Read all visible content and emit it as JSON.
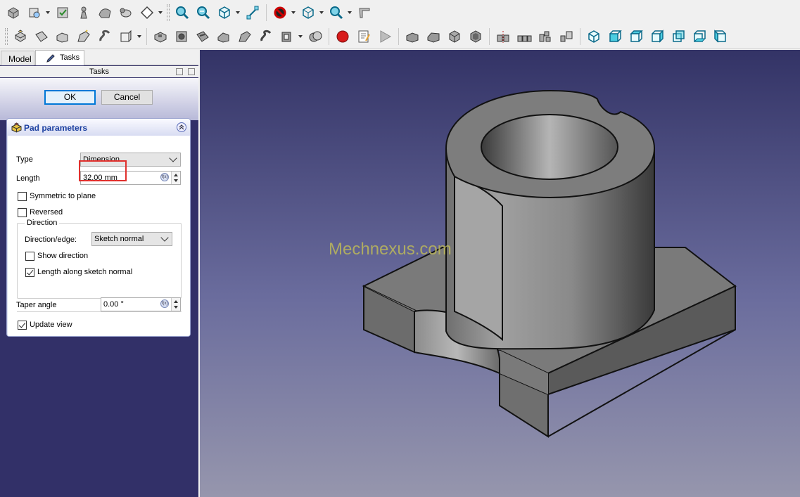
{
  "tabs": [
    {
      "label": "Model"
    },
    {
      "label": "Tasks"
    }
  ],
  "panel_title": "Tasks",
  "buttons": {
    "ok": "OK",
    "cancel": "Cancel"
  },
  "pad": {
    "title": "Pad parameters",
    "type_label": "Type",
    "type_value": "Dimension",
    "length_label": "Length",
    "length_value": "32.00 mm",
    "symmetric_label": "Symmetric to plane",
    "symmetric_checked": false,
    "reversed_label": "Reversed",
    "reversed_checked": false,
    "direction": {
      "group_title": "Direction",
      "edge_label": "Direction/edge:",
      "edge_value": "Sketch normal",
      "show_direction_label": "Show direction",
      "show_direction_checked": false,
      "along_normal_label": "Length along sketch normal",
      "along_normal_checked": true
    },
    "taper_label": "Taper angle",
    "taper_value": "0.00 °",
    "update_view_label": "Update view",
    "update_view_checked": true
  },
  "viewport": {
    "watermark": "Mechnexus.com"
  },
  "toolbar1_icons": [
    "part-icon",
    "clone-icon",
    "check-geometry-icon",
    "pawn-icon",
    "shape-binder-icon",
    "sheep-icon",
    "diamond-sketch-icon",
    "zoom-fit-icon",
    "zoom-selection-icon",
    "view-isometric-icon",
    "measure-icon",
    "no-draw-style-icon",
    "bounding-box-icon",
    "zoom-dropdown-icon",
    "caliper-icon"
  ],
  "toolbar2_icons": [
    "pad-icon",
    "revolution-icon",
    "additive-loft-icon",
    "additive-pipe-icon",
    "additive-helix-icon",
    "additive-primitive-icon",
    "pocket-icon",
    "hole-icon",
    "groove-icon",
    "subtractive-loft-icon",
    "subtractive-pipe-icon",
    "subtractive-helix-icon",
    "subtractive-primitive-icon",
    "boolean-icon",
    "macro-record-icon",
    "macro-edit-icon",
    "macro-execute-icon",
    "fillet-icon",
    "chamfer-icon",
    "draft-icon",
    "thickness-icon",
    "mirrored-icon",
    "linear-pattern-icon",
    "polar-pattern-icon",
    "multi-transform-icon",
    "view-isometric-icon",
    "view-front-icon",
    "view-top-icon",
    "view-right-icon",
    "view-rear-icon",
    "view-bottom-icon",
    "view-left-icon"
  ],
  "colors": {
    "accent": "#0078d7",
    "highlight": "#e0302d",
    "panel_bg": "#323068",
    "title_text": "#1b3fa0"
  }
}
